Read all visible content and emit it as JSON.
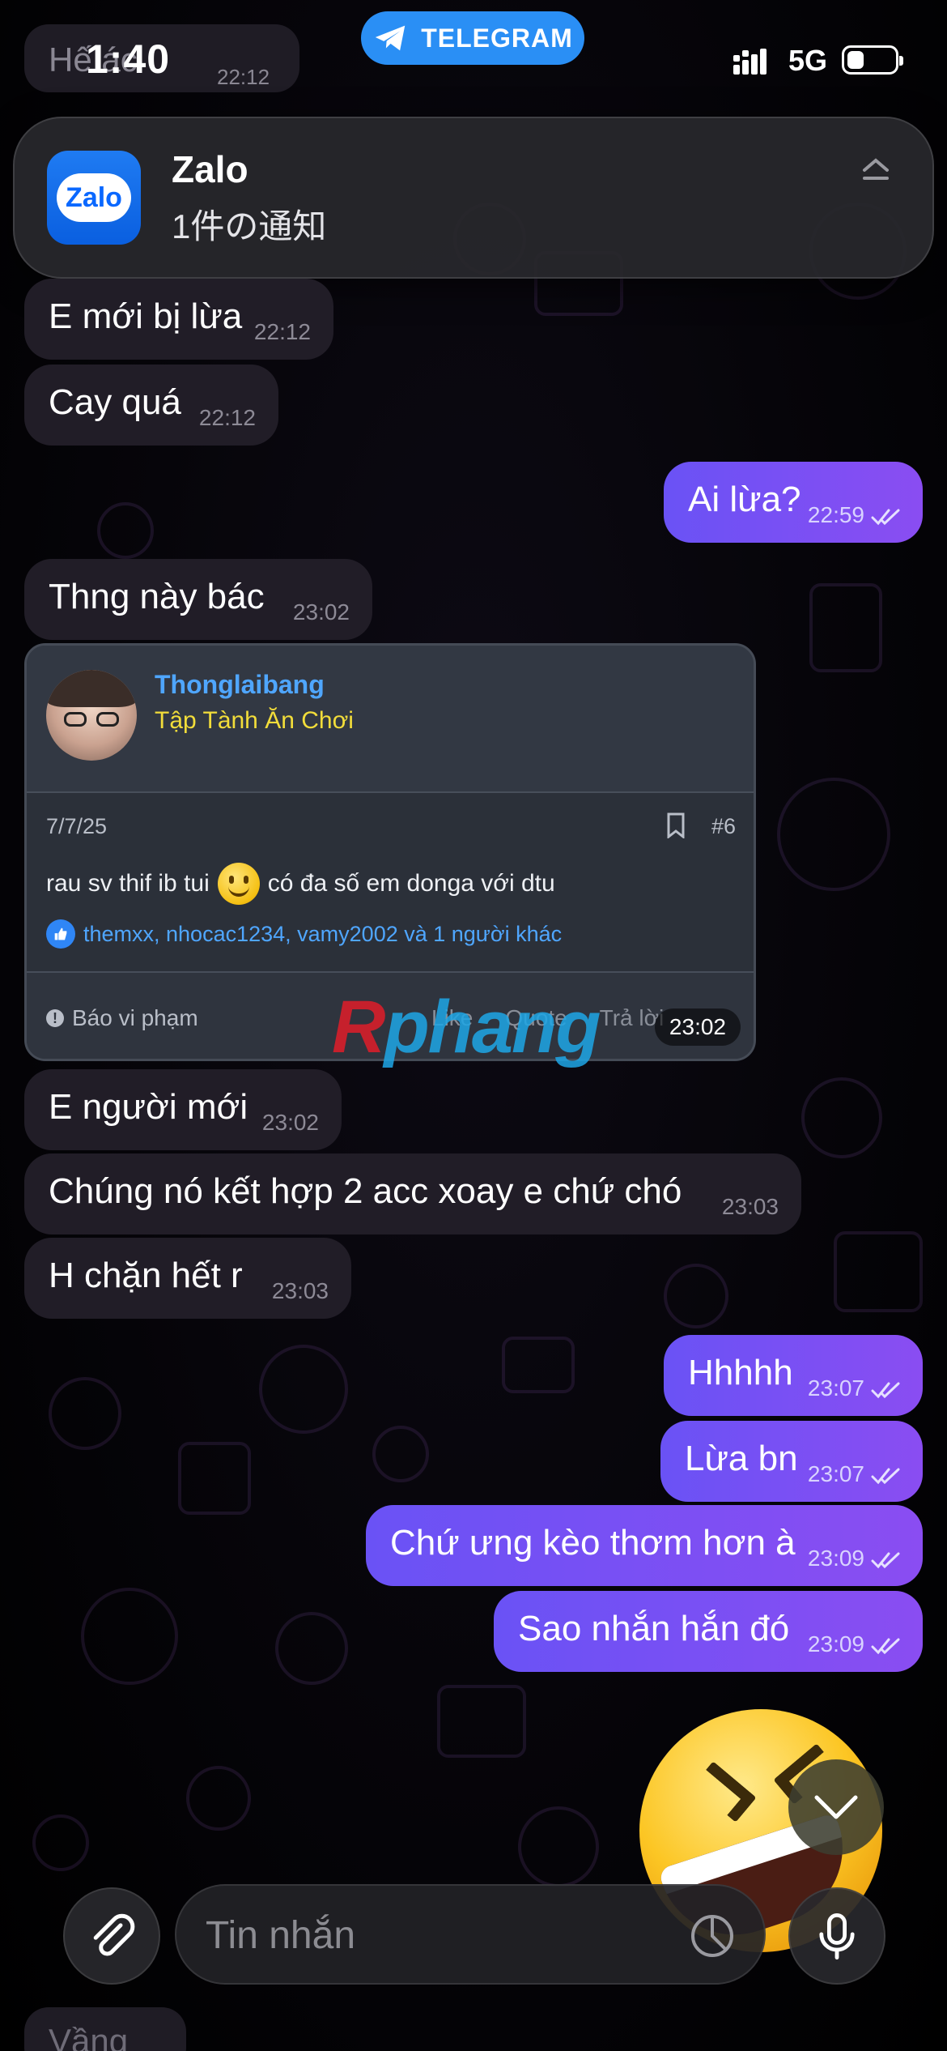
{
  "status_bar": {
    "time": "1:40",
    "pill_label": "TELEGRAM",
    "network": "5G",
    "battery_level": 0.35
  },
  "notification": {
    "app_name": "Zalo",
    "logo_text": "Zalo",
    "body": "1件の通知"
  },
  "chat": {
    "top_partial": "Hế      ác",
    "top_partial_time": "22:12",
    "messages": [
      {
        "dir": "in",
        "text": "E mới bị lừa",
        "time": "22:12"
      },
      {
        "dir": "in",
        "text": "Cay quá",
        "time": "22:12"
      },
      {
        "dir": "out",
        "text": "Ai lừa?",
        "time": "22:59"
      },
      {
        "dir": "in",
        "text": "Thng này bác",
        "time": "23:02"
      },
      {
        "dir": "in",
        "text": "E người mới",
        "time": "23:02"
      },
      {
        "dir": "in",
        "text": "Chúng nó kết hợp 2 acc xoay e chứ chó",
        "time": "23:03"
      },
      {
        "dir": "in",
        "text": "H chặn hết r",
        "time": "23:03"
      },
      {
        "dir": "out",
        "text": "Hhhhh",
        "time": "23:07"
      },
      {
        "dir": "out",
        "text": "Lừa bn",
        "time": "23:07"
      },
      {
        "dir": "out",
        "text": "Chứ ưng kèo thơm hơn à",
        "time": "23:09"
      },
      {
        "dir": "out",
        "text": "Sao nhắn hắn đó",
        "time": "23:09"
      }
    ],
    "bottom_partial": "Vầng"
  },
  "forum_card": {
    "username": "Thonglaibang",
    "user_title": "Tập Tành Ăn Chơi",
    "date": "7/7/25",
    "post_number": "#6",
    "text_before": "rau sv thif ib tui",
    "text_after": "có đa số em donga với dtu",
    "likes": "themxx, nhocac1234, vamy2002 và 1 người khác",
    "report": "Báo vi phạm",
    "actions": [
      "Like",
      "Quote",
      "Trả lời"
    ],
    "time": "23:02",
    "watermark_a": "R",
    "watermark_b": "phang"
  },
  "input": {
    "placeholder": "Tin nhắn"
  },
  "colors": {
    "outgoing": "#7a50f4",
    "incoming": "#211d27",
    "link": "#4fa6ff",
    "title_yellow": "#f2dd3a",
    "telegram_blue": "#2a8ff5"
  }
}
